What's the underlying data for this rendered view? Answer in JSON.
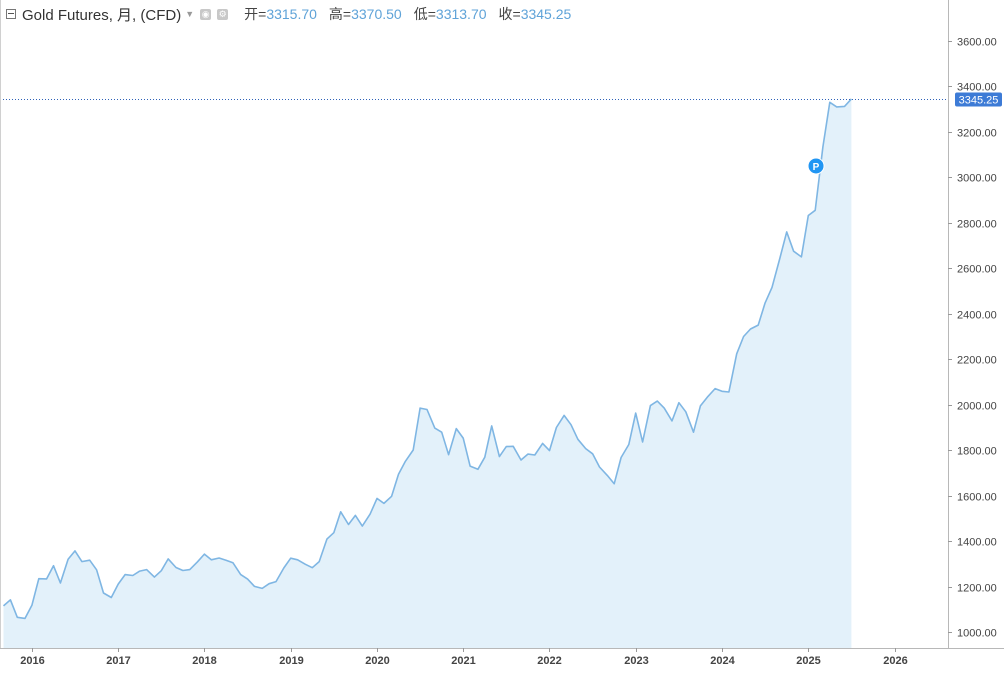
{
  "header": {
    "title": "Gold Futures, 月, (CFD)",
    "ohlc": [
      {
        "label": "开=",
        "value": "3315.70"
      },
      {
        "label": "高=",
        "value": "3370.50"
      },
      {
        "label": "低=",
        "value": "3313.70"
      },
      {
        "label": "收=",
        "value": "3345.25"
      }
    ]
  },
  "colors": {
    "line": "#7fb6e3",
    "fill": "#e3f1fa",
    "price_tag": "#3d7bd6",
    "marker": "#2196f3"
  },
  "chart_data": {
    "type": "area",
    "title": "Gold Futures, 月, (CFD)",
    "x_ticks": [
      "2016",
      "2017",
      "2018",
      "2019",
      "2020",
      "2021",
      "2022",
      "2023",
      "2024",
      "2025",
      "2026"
    ],
    "y_ticks": [
      "1000.00",
      "1200.00",
      "1400.00",
      "1600.00",
      "1800.00",
      "2000.00",
      "2200.00",
      "2400.00",
      "2600.00",
      "2800.00",
      "3000.00",
      "3200.00",
      "3400.00",
      "3600.00"
    ],
    "ylim": [
      930,
      3780
    ],
    "xlim": [
      2015.63,
      2026.62
    ],
    "last_price": "3345.25",
    "marker_label": "P",
    "marker_point": {
      "x": 2025.09,
      "y": 3050
    },
    "series": [
      {
        "x": [
          2015.67,
          2015.75,
          2015.83,
          2015.92,
          2016.0,
          2016.08,
          2016.17,
          2016.25,
          2016.33,
          2016.42,
          2016.5,
          2016.58,
          2016.67,
          2016.75,
          2016.83,
          2016.92,
          2017.0,
          2017.08,
          2017.17,
          2017.25,
          2017.33,
          2017.42,
          2017.5,
          2017.58,
          2017.67,
          2017.75,
          2017.83,
          2017.92,
          2018.0,
          2018.08,
          2018.17,
          2018.25,
          2018.33,
          2018.42,
          2018.5,
          2018.58,
          2018.67,
          2018.75,
          2018.83,
          2018.92,
          2019.0,
          2019.08,
          2019.17,
          2019.25,
          2019.33,
          2019.42,
          2019.5,
          2019.58,
          2019.67,
          2019.75,
          2019.83,
          2019.92,
          2020.0,
          2020.08,
          2020.17,
          2020.25,
          2020.33,
          2020.42,
          2020.5,
          2020.58,
          2020.67,
          2020.75,
          2020.83,
          2020.92,
          2021.0,
          2021.08,
          2021.17,
          2021.25,
          2021.33,
          2021.42,
          2021.5,
          2021.58,
          2021.67,
          2021.75,
          2021.83,
          2021.92,
          2022.0,
          2022.08,
          2022.17,
          2022.25,
          2022.33,
          2022.42,
          2022.5,
          2022.58,
          2022.67,
          2022.75,
          2022.83,
          2022.92,
          2023.0,
          2023.08,
          2023.17,
          2023.25,
          2023.33,
          2023.42,
          2023.5,
          2023.58,
          2023.67,
          2023.75,
          2023.83,
          2023.92,
          2024.0,
          2024.08,
          2024.17,
          2024.25,
          2024.33,
          2024.42,
          2024.5,
          2024.58,
          2024.67,
          2024.75,
          2024.83,
          2024.92,
          2025.0,
          2025.08,
          2025.17,
          2025.25,
          2025.33,
          2025.42,
          2025.5
        ],
        "y": [
          1115,
          1142,
          1065,
          1060,
          1118,
          1235,
          1234,
          1292,
          1216,
          1320,
          1357,
          1310,
          1316,
          1274,
          1172,
          1152,
          1211,
          1253,
          1249,
          1268,
          1275,
          1242,
          1270,
          1322,
          1284,
          1271,
          1275,
          1309,
          1343,
          1318,
          1326,
          1316,
          1305,
          1253,
          1233,
          1201,
          1192,
          1213,
          1222,
          1282,
          1325,
          1318,
          1298,
          1283,
          1310,
          1409,
          1437,
          1529,
          1473,
          1513,
          1466,
          1519,
          1588,
          1566,
          1597,
          1694,
          1751,
          1801,
          1985,
          1979,
          1897,
          1879,
          1780,
          1895,
          1853,
          1730,
          1716,
          1769,
          1907,
          1772,
          1816,
          1817,
          1757,
          1783,
          1779,
          1830,
          1798,
          1900,
          1953,
          1912,
          1848,
          1807,
          1784,
          1726,
          1689,
          1652,
          1768,
          1825,
          1963,
          1836,
          1996,
          2016,
          1985,
          1929,
          2009,
          1969,
          1879,
          1995,
          2033,
          2071,
          2059,
          2056,
          2224,
          2300,
          2333,
          2350,
          2448,
          2516,
          2643,
          2760,
          2675,
          2650,
          2832,
          2855,
          3134,
          3330,
          3310,
          3312,
          3345
        ]
      }
    ]
  }
}
